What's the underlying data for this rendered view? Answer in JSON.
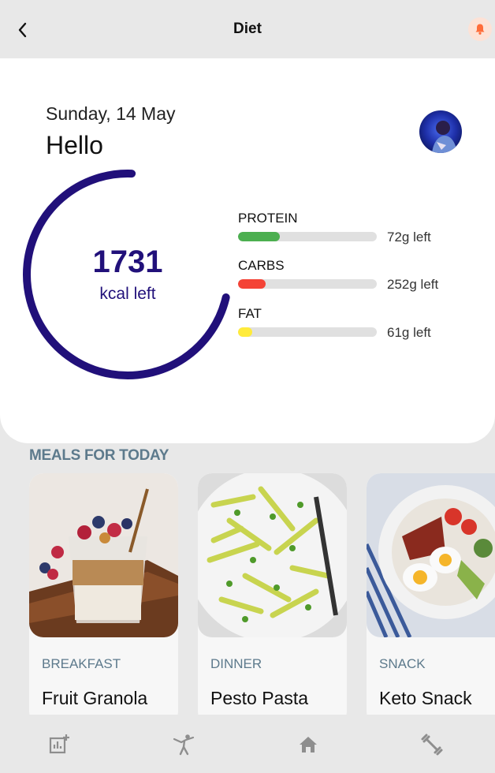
{
  "header": {
    "title": "Diet",
    "back_icon": "chevron-left-icon",
    "notification_icon": "bell-icon"
  },
  "summary": {
    "date": "Sunday, 14 May",
    "greeting": "Hello",
    "calories_left": "1731",
    "calories_unit": "kcal left",
    "calorie_progress": 0.72,
    "ring_color": "#21107a"
  },
  "macros": [
    {
      "name": "PROTEIN",
      "left": "72g left",
      "progress": 0.3,
      "color": "#4caf50"
    },
    {
      "name": "CARBS",
      "left": "252g left",
      "progress": 0.2,
      "color": "#f44336"
    },
    {
      "name": "FAT",
      "left": "61g left",
      "progress": 0.1,
      "color": "#ffeb3b"
    }
  ],
  "meals_section": {
    "title": "MEALS FOR TODAY",
    "items": [
      {
        "type": "BREAKFAST",
        "name": "Fruit Granola"
      },
      {
        "type": "DINNER",
        "name": "Pesto Pasta"
      },
      {
        "type": "SNACK",
        "name": "Keto Snack"
      }
    ]
  },
  "nav": [
    "stats-icon",
    "activity-icon",
    "home-icon",
    "workout-icon"
  ]
}
